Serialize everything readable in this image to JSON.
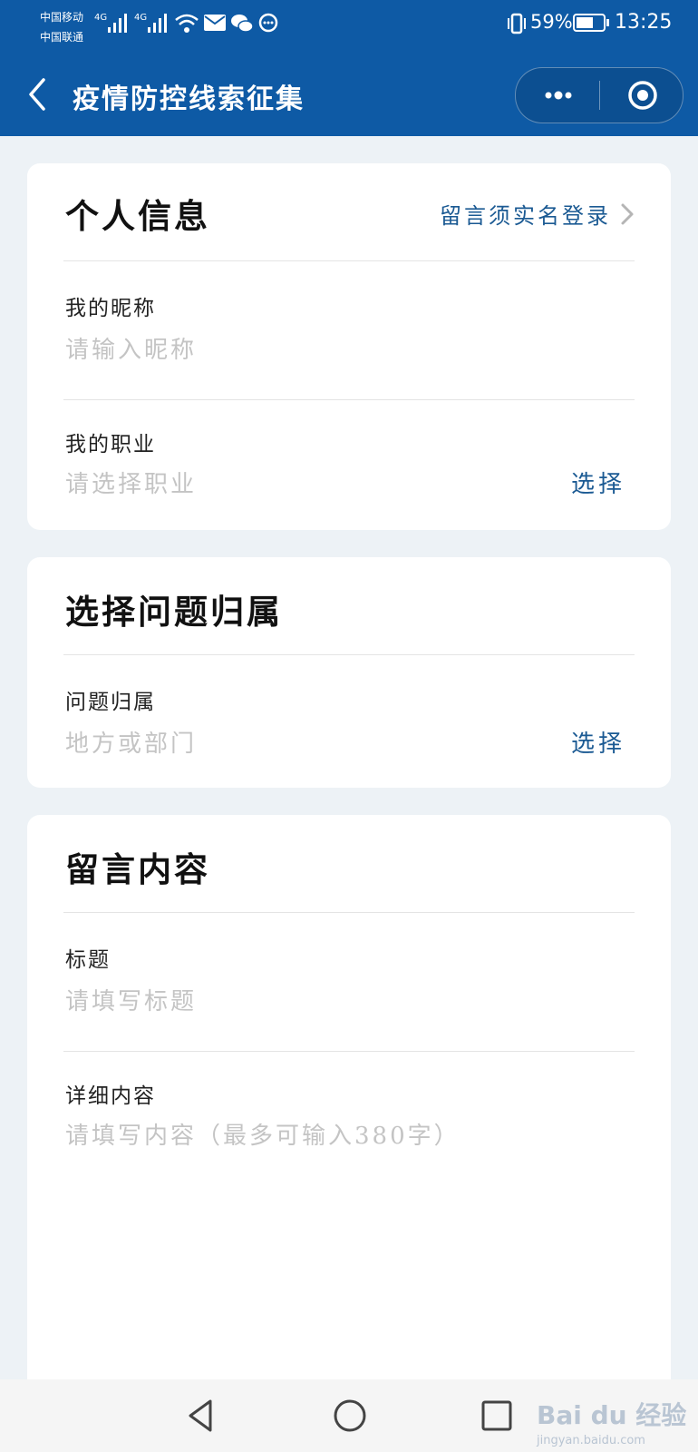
{
  "status_bar": {
    "carrier_1": "中国移动",
    "carrier_2": "中国联通",
    "network_1": "4G",
    "network_2": "4G",
    "battery": "59%",
    "time": "13:25"
  },
  "nav": {
    "title": "疫情防控线索征集"
  },
  "personal": {
    "title": "个人信息",
    "login_link": "留言须实名登录",
    "nickname_label": "我的昵称",
    "nickname_placeholder": "请输入昵称",
    "job_label": "我的职业",
    "job_placeholder": "请选择职业",
    "job_select": "选择"
  },
  "category": {
    "title": "选择问题归属",
    "label": "问题归属",
    "placeholder": "地方或部门",
    "select": "选择"
  },
  "message": {
    "title": "留言内容",
    "subject_label": "标题",
    "subject_placeholder": "请填写标题",
    "detail_label": "详细内容",
    "detail_placeholder": "请填写内容（最多可输入380字）"
  },
  "watermark": {
    "brand": "Bai du 经验",
    "url": "jingyan.baidu.com"
  },
  "colors": {
    "header": "#0e5aa5",
    "accent": "#1b5a93",
    "placeholder": "#c4c4c4"
  }
}
